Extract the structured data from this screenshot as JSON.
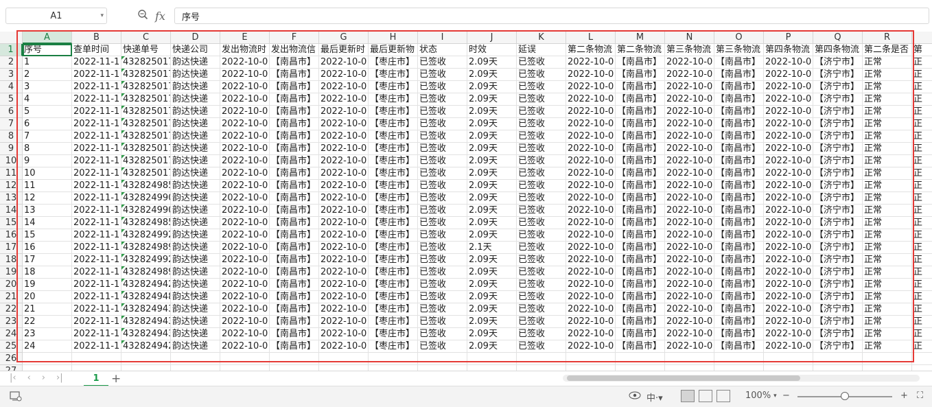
{
  "formula_bar": {
    "cell_ref": "A1",
    "fx_label": "fx",
    "content": "序号"
  },
  "columns": [
    "A",
    "B",
    "C",
    "D",
    "E",
    "F",
    "G",
    "H",
    "I",
    "J",
    "K",
    "L",
    "M",
    "N",
    "O",
    "P",
    "Q",
    "R"
  ],
  "row_numbers": [
    "1",
    "2",
    "3",
    "4",
    "5",
    "6",
    "7",
    "8",
    "9",
    "10",
    "11",
    "12",
    "13",
    "14",
    "15",
    "16",
    "17",
    "18",
    "19",
    "20",
    "21",
    "22",
    "23",
    "24",
    "25",
    "26",
    "27"
  ],
  "header_row": [
    "序号",
    "查单时间",
    "快递单号",
    "快递公司",
    "发出物流时",
    "发出物流信",
    "最后更新时",
    "最后更新物",
    "状态",
    "时效",
    "延误",
    "第二条物流",
    "第二条物流",
    "第三条物流",
    "第三条物流",
    "第四条物流",
    "第四条物流",
    "第二条是否",
    "第"
  ],
  "data_rows": [
    [
      "1",
      "2022-11-1",
      "432825017",
      "韵达快递",
      "2022-10-0",
      "【南昌市】",
      "2022-10-0",
      "【枣庄市】",
      "已签收",
      "2.09天",
      "已签收",
      "2022-10-0",
      "【南昌市】",
      "2022-10-0",
      "【南昌市】",
      "2022-10-0",
      "【济宁市】",
      "正常",
      "正"
    ],
    [
      "2",
      "2022-11-1",
      "432825017",
      "韵达快递",
      "2022-10-0",
      "【南昌市】",
      "2022-10-0",
      "【枣庄市】",
      "已签收",
      "2.09天",
      "已签收",
      "2022-10-0",
      "【南昌市】",
      "2022-10-0",
      "【南昌市】",
      "2022-10-0",
      "【济宁市】",
      "正常",
      "正"
    ],
    [
      "3",
      "2022-11-1",
      "432825017",
      "韵达快递",
      "2022-10-0",
      "【南昌市】",
      "2022-10-0",
      "【枣庄市】",
      "已签收",
      "2.09天",
      "已签收",
      "2022-10-0",
      "【南昌市】",
      "2022-10-0",
      "【南昌市】",
      "2022-10-0",
      "【济宁市】",
      "正常",
      "正"
    ],
    [
      "4",
      "2022-11-1",
      "432825017",
      "韵达快递",
      "2022-10-0",
      "【南昌市】",
      "2022-10-0",
      "【枣庄市】",
      "已签收",
      "2.09天",
      "已签收",
      "2022-10-0",
      "【南昌市】",
      "2022-10-0",
      "【南昌市】",
      "2022-10-0",
      "【济宁市】",
      "正常",
      "正"
    ],
    [
      "5",
      "2022-11-1",
      "432825017",
      "韵达快递",
      "2022-10-0",
      "【南昌市】",
      "2022-10-0",
      "【枣庄市】",
      "已签收",
      "2.09天",
      "已签收",
      "2022-10-0",
      "【南昌市】",
      "2022-10-0",
      "【南昌市】",
      "2022-10-0",
      "【济宁市】",
      "正常",
      "正"
    ],
    [
      "6",
      "2022-11-1",
      "432825017",
      "韵达快递",
      "2022-10-0",
      "【南昌市】",
      "2022-10-0",
      "【枣庄市】",
      "已签收",
      "2.09天",
      "已签收",
      "2022-10-0",
      "【南昌市】",
      "2022-10-0",
      "【南昌市】",
      "2022-10-0",
      "【济宁市】",
      "正常",
      "正"
    ],
    [
      "7",
      "2022-11-1",
      "432825017",
      "韵达快递",
      "2022-10-0",
      "【南昌市】",
      "2022-10-0",
      "【枣庄市】",
      "已签收",
      "2.09天",
      "已签收",
      "2022-10-0",
      "【南昌市】",
      "2022-10-0",
      "【南昌市】",
      "2022-10-0",
      "【济宁市】",
      "正常",
      "正"
    ],
    [
      "8",
      "2022-11-1",
      "432825017",
      "韵达快递",
      "2022-10-0",
      "【南昌市】",
      "2022-10-0",
      "【枣庄市】",
      "已签收",
      "2.09天",
      "已签收",
      "2022-10-0",
      "【南昌市】",
      "2022-10-0",
      "【南昌市】",
      "2022-10-0",
      "【济宁市】",
      "正常",
      "正"
    ],
    [
      "9",
      "2022-11-1",
      "432825017",
      "韵达快递",
      "2022-10-0",
      "【南昌市】",
      "2022-10-0",
      "【枣庄市】",
      "已签收",
      "2.09天",
      "已签收",
      "2022-10-0",
      "【南昌市】",
      "2022-10-0",
      "【南昌市】",
      "2022-10-0",
      "【济宁市】",
      "正常",
      "正"
    ],
    [
      "10",
      "2022-11-1",
      "432825017",
      "韵达快递",
      "2022-10-0",
      "【南昌市】",
      "2022-10-0",
      "【枣庄市】",
      "已签收",
      "2.09天",
      "已签收",
      "2022-10-0",
      "【南昌市】",
      "2022-10-0",
      "【南昌市】",
      "2022-10-0",
      "【济宁市】",
      "正常",
      "正"
    ],
    [
      "11",
      "2022-11-1",
      "432824985",
      "韵达快递",
      "2022-10-0",
      "【南昌市】",
      "2022-10-0",
      "【枣庄市】",
      "已签收",
      "2.09天",
      "已签收",
      "2022-10-0",
      "【南昌市】",
      "2022-10-0",
      "【南昌市】",
      "2022-10-0",
      "【济宁市】",
      "正常",
      "正"
    ],
    [
      "12",
      "2022-11-1",
      "432824990",
      "韵达快递",
      "2022-10-0",
      "【南昌市】",
      "2022-10-0",
      "【枣庄市】",
      "已签收",
      "2.09天",
      "已签收",
      "2022-10-0",
      "【南昌市】",
      "2022-10-0",
      "【南昌市】",
      "2022-10-0",
      "【济宁市】",
      "正常",
      "正"
    ],
    [
      "13",
      "2022-11-1",
      "432824990",
      "韵达快递",
      "2022-10-0",
      "【南昌市】",
      "2022-10-0",
      "【枣庄市】",
      "已签收",
      "2.09天",
      "已签收",
      "2022-10-0",
      "【南昌市】",
      "2022-10-0",
      "【南昌市】",
      "2022-10-0",
      "【济宁市】",
      "正常",
      "正"
    ],
    [
      "14",
      "2022-11-1",
      "432824985",
      "韵达快递",
      "2022-10-0",
      "【南昌市】",
      "2022-10-0",
      "【枣庄市】",
      "已签收",
      "2.09天",
      "已签收",
      "2022-10-0",
      "【南昌市】",
      "2022-10-0",
      "【南昌市】",
      "2022-10-0",
      "【济宁市】",
      "正常",
      "正"
    ],
    [
      "15",
      "2022-11-1",
      "432824992",
      "韵达快递",
      "2022-10-0",
      "【南昌市】",
      "2022-10-0",
      "【枣庄市】",
      "已签收",
      "2.09天",
      "已签收",
      "2022-10-0",
      "【南昌市】",
      "2022-10-0",
      "【南昌市】",
      "2022-10-0",
      "【济宁市】",
      "正常",
      "正"
    ],
    [
      "16",
      "2022-11-1",
      "432824989",
      "韵达快递",
      "2022-10-0",
      "【南昌市】",
      "2022-10-0",
      "【枣庄市】",
      "已签收",
      "2.1天",
      "已签收",
      "2022-10-0",
      "【南昌市】",
      "2022-10-0",
      "【南昌市】",
      "2022-10-0",
      "【济宁市】",
      "正常",
      "正"
    ],
    [
      "17",
      "2022-11-1",
      "432824992",
      "韵达快递",
      "2022-10-0",
      "【南昌市】",
      "2022-10-0",
      "【枣庄市】",
      "已签收",
      "2.09天",
      "已签收",
      "2022-10-0",
      "【南昌市】",
      "2022-10-0",
      "【南昌市】",
      "2022-10-0",
      "【济宁市】",
      "正常",
      "正"
    ],
    [
      "18",
      "2022-11-1",
      "432824989",
      "韵达快递",
      "2022-10-0",
      "【南昌市】",
      "2022-10-0",
      "【枣庄市】",
      "已签收",
      "2.09天",
      "已签收",
      "2022-10-0",
      "【南昌市】",
      "2022-10-0",
      "【南昌市】",
      "2022-10-0",
      "【济宁市】",
      "正常",
      "正"
    ],
    [
      "19",
      "2022-11-1",
      "432824942",
      "韵达快递",
      "2022-10-0",
      "【南昌市】",
      "2022-10-0",
      "【枣庄市】",
      "已签收",
      "2.09天",
      "已签收",
      "2022-10-0",
      "【南昌市】",
      "2022-10-0",
      "【南昌市】",
      "2022-10-0",
      "【济宁市】",
      "正常",
      "正"
    ],
    [
      "20",
      "2022-11-1",
      "432824948",
      "韵达快递",
      "2022-10-0",
      "【南昌市】",
      "2022-10-0",
      "【枣庄市】",
      "已签收",
      "2.09天",
      "已签收",
      "2022-10-0",
      "【南昌市】",
      "2022-10-0",
      "【南昌市】",
      "2022-10-0",
      "【济宁市】",
      "正常",
      "正"
    ],
    [
      "21",
      "2022-11-1",
      "432824943",
      "韵达快递",
      "2022-10-0",
      "【南昌市】",
      "2022-10-0",
      "【枣庄市】",
      "已签收",
      "2.09天",
      "已签收",
      "2022-10-0",
      "【南昌市】",
      "2022-10-0",
      "【南昌市】",
      "2022-10-0",
      "【济宁市】",
      "正常",
      "正"
    ],
    [
      "22",
      "2022-11-1",
      "432824943",
      "韵达快递",
      "2022-10-0",
      "【南昌市】",
      "2022-10-0",
      "【枣庄市】",
      "已签收",
      "2.09天",
      "已签收",
      "2022-10-0",
      "【南昌市】",
      "2022-10-0",
      "【南昌市】",
      "2022-10-0",
      "【济宁市】",
      "正常",
      "正"
    ],
    [
      "23",
      "2022-11-1",
      "432824943",
      "韵达快递",
      "2022-10-0",
      "【南昌市】",
      "2022-10-0",
      "【枣庄市】",
      "已签收",
      "2.09天",
      "已签收",
      "2022-10-0",
      "【南昌市】",
      "2022-10-0",
      "【南昌市】",
      "2022-10-0",
      "【济宁市】",
      "正常",
      "正"
    ],
    [
      "24",
      "2022-11-1",
      "432824942",
      "韵达快递",
      "2022-10-0",
      "【南昌市】",
      "2022-10-0",
      "【枣庄市】",
      "已签收",
      "2.09天",
      "已签收",
      "2022-10-0",
      "【南昌市】",
      "2022-10-0",
      "【南昌市】",
      "2022-10-0",
      "【济宁市】",
      "正常",
      "正"
    ]
  ],
  "sheet_tabs": [
    {
      "label": "1",
      "active": true
    }
  ],
  "status_bar": {
    "zoom": "100%"
  },
  "colors": {
    "accent": "#1a9a49",
    "highlight_box": "#e53935",
    "header_bg": "#f5f5f5"
  }
}
